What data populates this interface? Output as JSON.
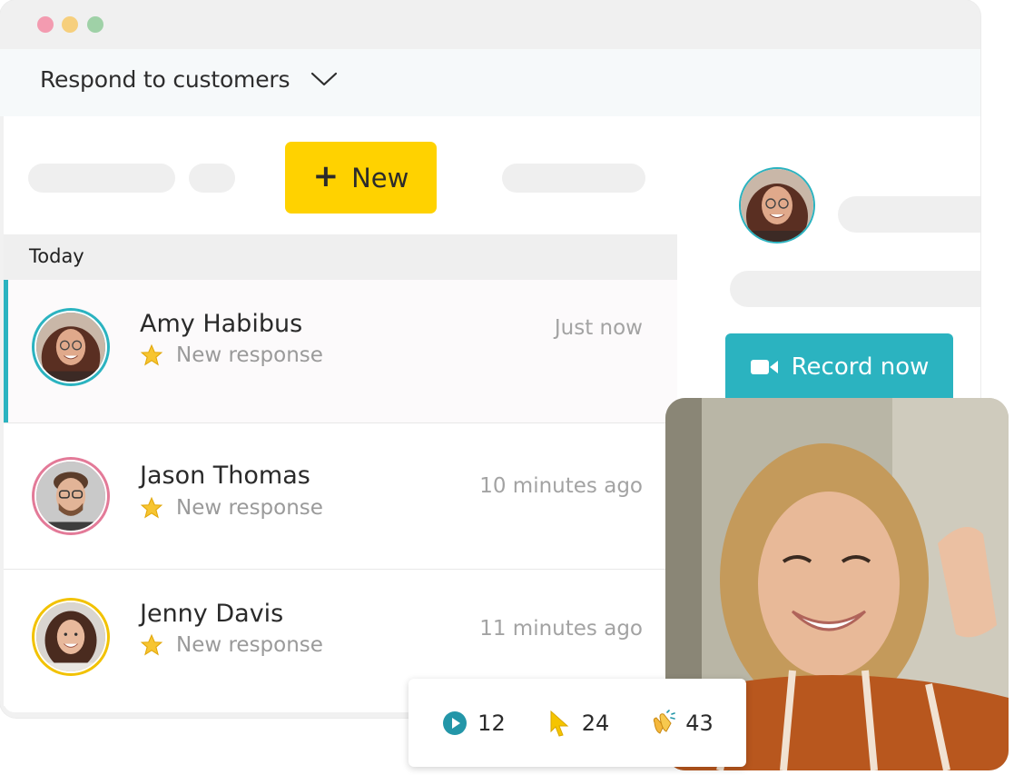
{
  "window": {
    "title": "Respond to customers"
  },
  "list": {
    "new_button_label": "New",
    "section_title": "Today",
    "items": [
      {
        "name": "Amy Habibus",
        "status": "New response",
        "time": "Just now",
        "ring": "#2bb3c0"
      },
      {
        "name": "Jason Thomas",
        "status": "New response",
        "time": "10 minutes ago",
        "ring": "#e37a98"
      },
      {
        "name": "Jenny Davis",
        "status": "New response",
        "time": "11 minutes ago",
        "ring": "#f2c200"
      }
    ]
  },
  "detail": {
    "record_label": "Record now"
  },
  "stats": {
    "plays": "12",
    "clicks": "24",
    "claps": "43"
  },
  "colors": {
    "accent": "#2bb3c0",
    "new_button": "#ffd200"
  },
  "icons": [
    "chevron-down-icon",
    "plus-icon",
    "star-icon",
    "video-camera-icon",
    "play-icon",
    "cursor-icon",
    "clap-icon"
  ]
}
